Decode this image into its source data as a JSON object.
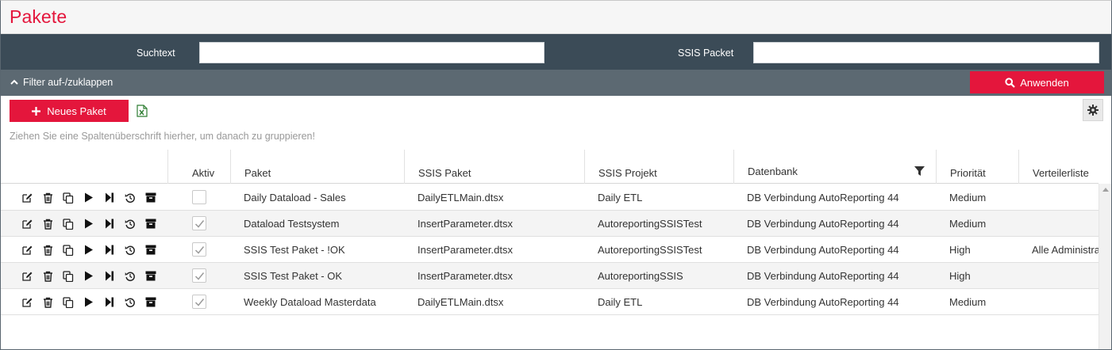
{
  "page": {
    "title": "Pakete"
  },
  "filters": {
    "suchtext_label": "Suchtext",
    "suchtext_value": "",
    "ssis_packet_label": "SSIS Packet",
    "ssis_packet_value": "",
    "toggle_label": "Filter auf-/zuklappen",
    "apply_label": "Anwenden"
  },
  "toolbar": {
    "new_package_label": "Neues Paket"
  },
  "grid": {
    "group_hint": "Ziehen Sie eine Spaltenüberschrift hierher, um danach zu gruppieren!",
    "columns": [
      "Aktiv",
      "Paket",
      "SSIS Paket",
      "SSIS Projekt",
      "Datenbank",
      "Priorität",
      "Verteilerliste"
    ],
    "rows": [
      {
        "aktiv": false,
        "paket": "Daily Dataload - Sales",
        "ssis_paket": "DailyETLMain.dtsx",
        "ssis_projekt": "Daily ETL",
        "datenbank": "DB Verbindung AutoReporting 44",
        "prioritaet": "Medium",
        "verteilerliste": ""
      },
      {
        "aktiv": true,
        "paket": "Dataload Testsystem",
        "ssis_paket": "InsertParameter.dtsx",
        "ssis_projekt": "AutoreportingSSISTest",
        "datenbank": "DB Verbindung AutoReporting 44",
        "prioritaet": "Medium",
        "verteilerliste": ""
      },
      {
        "aktiv": true,
        "paket": "SSIS Test Paket - !OK",
        "ssis_paket": "InsertParameter.dtsx",
        "ssis_projekt": "AutoreportingSSISTest",
        "datenbank": "DB Verbindung AutoReporting 44",
        "prioritaet": "High",
        "verteilerliste": "Alle Administra"
      },
      {
        "aktiv": true,
        "paket": "SSIS Test Paket - OK",
        "ssis_paket": "InsertParameter.dtsx",
        "ssis_projekt": "AutoreportingSSIS",
        "datenbank": "DB Verbindung AutoReporting 44",
        "prioritaet": "High",
        "verteilerliste": ""
      },
      {
        "aktiv": true,
        "paket": "Weekly Dataload Masterdata",
        "ssis_paket": "DailyETLMain.dtsx",
        "ssis_projekt": "Daily ETL",
        "datenbank": "DB Verbindung AutoReporting 44",
        "prioritaet": "Medium",
        "verteilerliste": ""
      }
    ],
    "row_actions": [
      "edit-icon",
      "delete-icon",
      "copy-icon",
      "play-icon",
      "step-forward-icon",
      "history-icon",
      "archive-icon"
    ]
  },
  "colors": {
    "accent": "#e4163c",
    "filterbar": "#3b4b57",
    "togglebar": "#5c6972"
  }
}
